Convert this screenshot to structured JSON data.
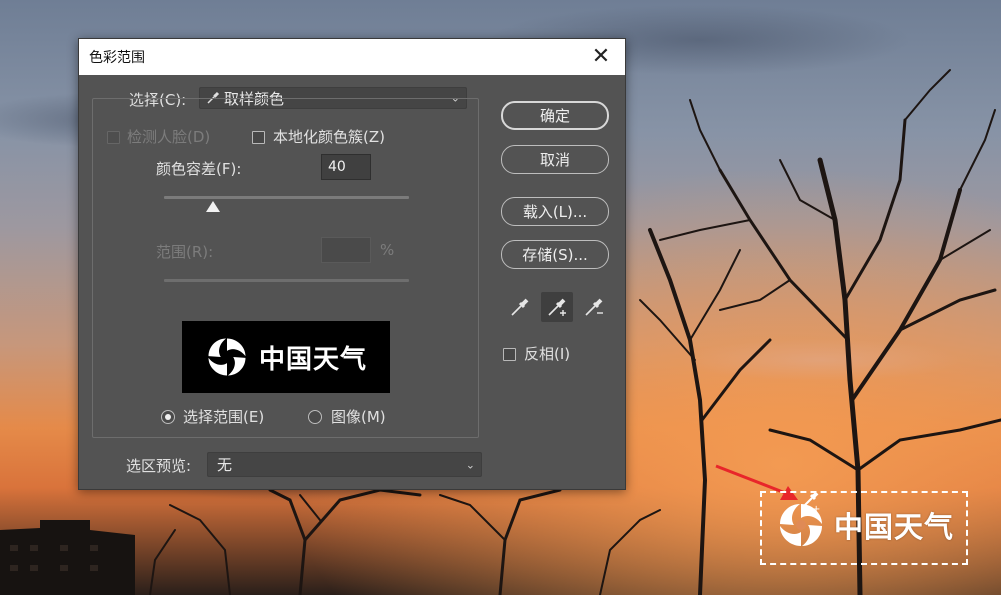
{
  "dialog": {
    "title": "色彩范围",
    "close_glyph": "✕",
    "select_label": "选择(C):",
    "select_value": "取样颜色",
    "detect_faces_label": "检测人脸(D)",
    "localized_clusters_label": "本地化颜色簇(Z)",
    "fuzziness_label": "颜色容差(F):",
    "fuzziness_value": "40",
    "range_label": "范围(R):",
    "range_percent": "%",
    "preview_logo_text": "中国天气",
    "radio_selection_label": "选择范围(E)",
    "radio_image_label": "图像(M)",
    "selection_preview_label": "选区预览:",
    "selection_preview_value": "无",
    "invert_label": "反相(I)"
  },
  "buttons": {
    "ok": "确定",
    "cancel": "取消",
    "load": "载入(L)...",
    "save": "存储(S)..."
  },
  "eyedroppers": [
    "eyedropper-icon",
    "eyedropper-plus-icon",
    "eyedropper-minus-icon"
  ],
  "canvas": {
    "watermark_text": "中国天气"
  },
  "colors": {
    "dialog_bg": "#535353",
    "arrow": "#e8262a"
  },
  "state": {
    "fuzziness_fraction": 0.2,
    "active_eyedropper": "eyedropper-plus-icon",
    "selected_radio": "selection"
  }
}
